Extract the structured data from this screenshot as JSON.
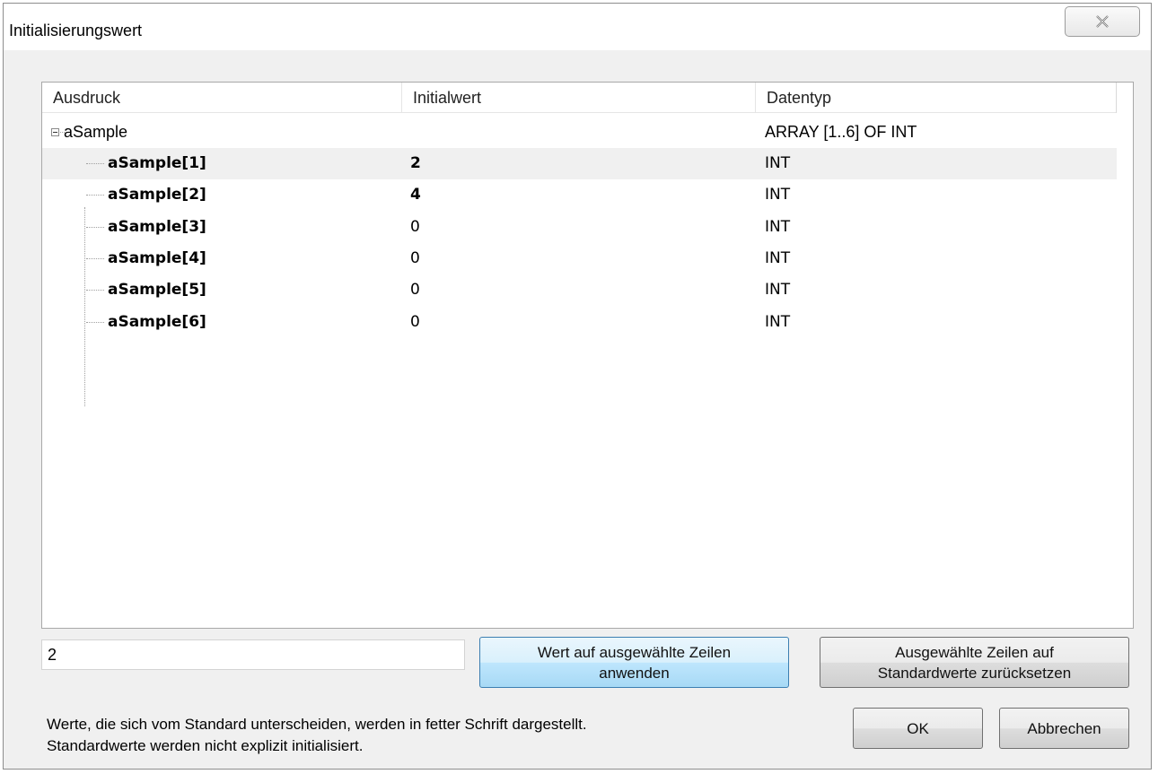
{
  "window": {
    "title": "Initialisierungswert"
  },
  "columns": {
    "expression": "Ausdruck",
    "initial_value": "Initialwert",
    "data_type": "Datentyp"
  },
  "tree": {
    "root": {
      "name": "aSample",
      "type": "ARRAY [1..6] OF INT"
    },
    "children": [
      {
        "name": "aSample[1]",
        "value": "2",
        "type": "INT",
        "value_bold": true,
        "selected": true
      },
      {
        "name": "aSample[2]",
        "value": "4",
        "type": "INT",
        "value_bold": true,
        "selected": false
      },
      {
        "name": "aSample[3]",
        "value": "0",
        "type": "INT",
        "value_bold": false,
        "selected": false
      },
      {
        "name": "aSample[4]",
        "value": "0",
        "type": "INT",
        "value_bold": false,
        "selected": false
      },
      {
        "name": "aSample[5]",
        "value": "0",
        "type": "INT",
        "value_bold": false,
        "selected": false
      },
      {
        "name": "aSample[6]",
        "value": "0",
        "type": "INT",
        "value_bold": false,
        "selected": false
      }
    ]
  },
  "editor": {
    "value": "2",
    "apply_label_line1": "Wert auf ausgewählte Zeilen",
    "apply_label_line2": "anwenden",
    "reset_label_line1": "Ausgewählte Zeilen auf",
    "reset_label_line2": "Standardwerte zurücksetzen"
  },
  "hint": {
    "line1": "Werte, die sich vom Standard unterscheiden, werden in fetter Schrift dargestellt.",
    "line2": "Standardwerte werden nicht explizit initialisiert."
  },
  "buttons": {
    "ok": "OK",
    "cancel": "Abbrechen"
  },
  "icons": {
    "close": "close-icon",
    "collapse": "collapse-icon"
  }
}
